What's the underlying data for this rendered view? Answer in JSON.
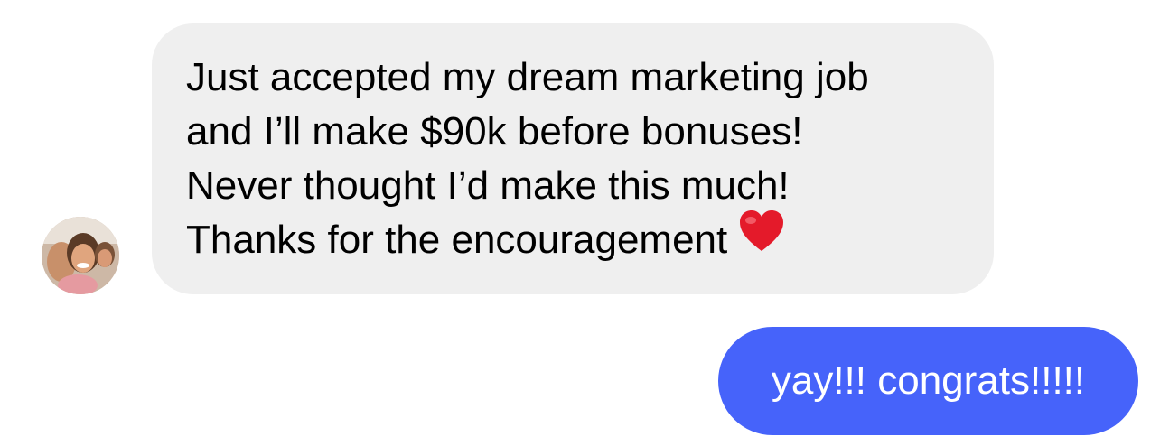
{
  "conversation": {
    "incoming": {
      "lines": [
        "Just accepted my dream marketing job",
        "and I’ll make $90k before bonuses!",
        "Never thought I’d make this much!",
        "Thanks for the encouragement"
      ],
      "emoji": "red-heart-icon",
      "bubble_color": "#efefef"
    },
    "outgoing": {
      "text": "yay!!! congrats!!!!!",
      "bubble_color": "#4663fa"
    }
  }
}
